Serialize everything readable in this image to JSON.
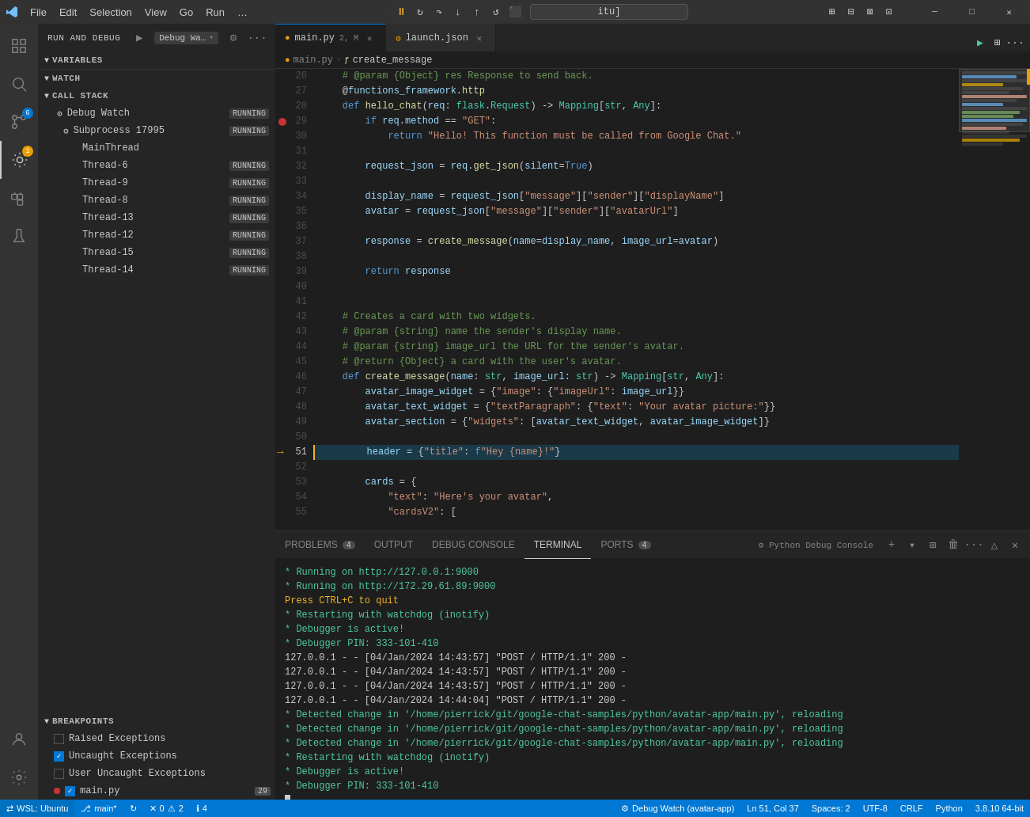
{
  "titlebar": {
    "menus": [
      "File",
      "Edit",
      "Selection",
      "View",
      "Go",
      "Run",
      "…"
    ],
    "address": "itu]",
    "win_buttons": [
      "─",
      "□",
      "✕"
    ]
  },
  "sidebar": {
    "run_debug_title": "RUN AND DEBUG",
    "config_label": "Debug Wa…",
    "sections": {
      "variables": "VARIABLES",
      "watch": "WATCH",
      "call_stack": "CALL STACK",
      "breakpoints": "BREAKPOINTS"
    },
    "call_stack_items": [
      {
        "label": "Debug Watch",
        "indent": 1,
        "badge": "RUNNING"
      },
      {
        "label": "Subprocess 17995",
        "indent": 2,
        "badge": "RUNNING"
      },
      {
        "label": "MainThread",
        "indent": 3,
        "badge": ""
      },
      {
        "label": "Thread-6",
        "indent": 3,
        "badge": "RUNNING"
      },
      {
        "label": "Thread-9",
        "indent": 3,
        "badge": "RUNNING"
      },
      {
        "label": "Thread-8",
        "indent": 3,
        "badge": "RUNNING"
      },
      {
        "label": "Thread-13",
        "indent": 3,
        "badge": "RUNNING"
      },
      {
        "label": "Thread-12",
        "indent": 3,
        "badge": "RUNNING"
      },
      {
        "label": "Thread-15",
        "indent": 3,
        "badge": "RUNNING"
      },
      {
        "label": "Thread-14",
        "indent": 3,
        "badge": "RUNNING"
      }
    ],
    "breakpoints": [
      {
        "label": "Raised Exceptions",
        "checked": false,
        "type": "checkbox"
      },
      {
        "label": "Uncaught Exceptions",
        "checked": true,
        "type": "checkbox"
      },
      {
        "label": "User Uncaught Exceptions",
        "checked": false,
        "type": "checkbox"
      },
      {
        "label": "main.py",
        "checked": true,
        "type": "file",
        "count": "29"
      }
    ]
  },
  "editor": {
    "tabs": [
      {
        "label": "main.py",
        "modified": true,
        "active": true,
        "indicator": "2, M"
      },
      {
        "label": "launch.json",
        "modified": false,
        "active": false
      }
    ],
    "breadcrumb": [
      "main.py",
      "create_message"
    ],
    "lines": [
      {
        "num": 26,
        "content": "    # @param {Object} res Response to send back."
      },
      {
        "num": 27,
        "content": "    @functions_framework.http"
      },
      {
        "num": 28,
        "content": "    def hello_chat(req: flask.Request) -> Mapping[str, Any]:"
      },
      {
        "num": 29,
        "content": "        if req.method == \"GET\":",
        "breakpoint": true
      },
      {
        "num": 30,
        "content": "            return \"Hello! This function must be called from Google Chat.\""
      },
      {
        "num": 31,
        "content": ""
      },
      {
        "num": 32,
        "content": "        request_json = req.get_json(silent=True)"
      },
      {
        "num": 33,
        "content": ""
      },
      {
        "num": 34,
        "content": "        display_name = request_json[\"message\"][\"sender\"][\"displayName\"]"
      },
      {
        "num": 35,
        "content": "        avatar = request_json[\"message\"][\"sender\"][\"avatarUrl\"]"
      },
      {
        "num": 36,
        "content": ""
      },
      {
        "num": 37,
        "content": "        response = create_message(name=display_name, image_url=avatar)"
      },
      {
        "num": 38,
        "content": ""
      },
      {
        "num": 39,
        "content": "        return response"
      },
      {
        "num": 40,
        "content": ""
      },
      {
        "num": 41,
        "content": ""
      },
      {
        "num": 42,
        "content": "    # Creates a card with two widgets."
      },
      {
        "num": 43,
        "content": "    # @param {string} name the sender's display name."
      },
      {
        "num": 44,
        "content": "    # @param {string} image_url the URL for the sender's avatar."
      },
      {
        "num": 45,
        "content": "    # @return {Object} a card with the user's avatar."
      },
      {
        "num": 46,
        "content": "    def create_message(name: str, image_url: str) -> Mapping[str, Any]:"
      },
      {
        "num": 47,
        "content": "        avatar_image_widget = {\"image\": {\"imageUrl\": image_url}}"
      },
      {
        "num": 48,
        "content": "        avatar_text_widget = {\"textParagraph\": {\"text\": \"Your avatar picture:\"}}"
      },
      {
        "num": 49,
        "content": "        avatar_section = {\"widgets\": [avatar_text_widget, avatar_image_widget]}"
      },
      {
        "num": 50,
        "content": ""
      },
      {
        "num": 51,
        "content": "        header = {\"title\": f\"Hey {name}!\"}",
        "debug_current": true
      },
      {
        "num": 52,
        "content": ""
      },
      {
        "num": 53,
        "content": "        cards = {"
      },
      {
        "num": 54,
        "content": "            \"text\": \"Here's your avatar\","
      },
      {
        "num": 55,
        "content": "            \"cardsV2\": ["
      }
    ]
  },
  "terminal": {
    "tabs": [
      "PROBLEMS",
      "OUTPUT",
      "DEBUG CONSOLE",
      "TERMINAL",
      "PORTS"
    ],
    "tab_badges": {
      "PROBLEMS": "4",
      "PORTS": "4"
    },
    "active_tab": "TERMINAL",
    "python_debug": "Python Debug Console",
    "lines": [
      " * Running on http://127.0.0.1:9000",
      " * Running on http://172.29.61.89:9000",
      "Press CTRL+C to quit",
      " * Restarting with watchdog (inotify)",
      " * Debugger is active!",
      " * Debugger PIN: 333-101-410",
      "127.0.0.1 - - [04/Jan/2024 14:43:57] \"POST / HTTP/1.1\" 200 -",
      "127.0.0.1 - - [04/Jan/2024 14:43:57] \"POST / HTTP/1.1\" 200 -",
      "127.0.0.1 - - [04/Jan/2024 14:43:57] \"POST / HTTP/1.1\" 200 -",
      "127.0.0.1 - - [04/Jan/2024 14:44:04] \"POST / HTTP/1.1\" 200 -",
      " * Detected change in '/home/pierrick/git/google-chat-samples/python/avatar-app/main.py', reloading",
      " * Detected change in '/home/pierrick/git/google-chat-samples/python/avatar-app/main.py', reloading",
      " * Detected change in '/home/pierrick/git/google-chat-samples/python/avatar-app/main.py', reloading",
      " * Restarting with watchdog (inotify)",
      " * Debugger is active!",
      " * Debugger PIN: 333-101-410"
    ]
  },
  "statusbar": {
    "left": [
      {
        "icon": "remote",
        "label": "WSL: Ubuntu"
      },
      {
        "icon": "git",
        "label": "main*"
      },
      {
        "icon": "sync",
        "label": ""
      },
      {
        "icon": "error",
        "label": "0"
      },
      {
        "icon": "warning",
        "label": "2"
      },
      {
        "icon": "info",
        "label": "4"
      }
    ],
    "right": [
      {
        "label": "Debug Watch (avatar-app)"
      },
      {
        "label": "Ln 51, Col 37"
      },
      {
        "label": "Spaces: 2"
      },
      {
        "label": "UTF-8"
      },
      {
        "label": "CRLF"
      },
      {
        "label": "Python"
      },
      {
        "label": "3.8.10 64-bit"
      }
    ]
  }
}
